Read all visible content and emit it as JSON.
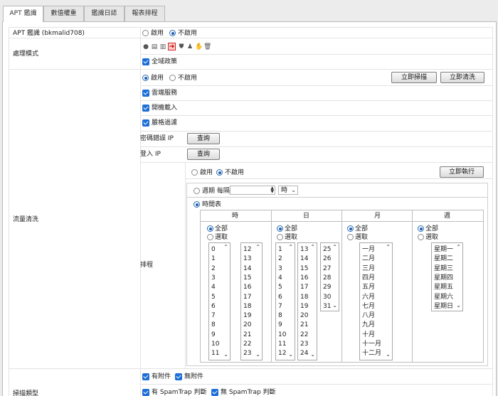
{
  "tabs": [
    "APT 鑑識",
    "數值權重",
    "鑑識日誌",
    "報表排程"
  ],
  "row_apt": {
    "label": "APT 鑑識 (bkmalid708)",
    "opt_on": "啟用",
    "opt_off": "不啟用"
  },
  "mode": {
    "label": "處理模式",
    "icons": [
      "eye-icon",
      "document-icon",
      "table-icon",
      "redirect-icon",
      "shield-icon",
      "user-icon",
      "hand-icon",
      "trash-icon"
    ],
    "global_policy": "全域政策"
  },
  "flow": {
    "label": "流量清洗",
    "opt_on": "啟用",
    "opt_off": "不啟用",
    "scan_now": "立即掃描",
    "clean_now": "立即清洗",
    "cloud": "雲端服務",
    "boot_load": "開機載入",
    "strict_filter": "嚴格過濾",
    "pwd_err_ip": "密碼錯誤 IP",
    "login_ip": "登入 IP",
    "query": "查詢"
  },
  "schedule": {
    "label": "排程",
    "opt_on": "啟用",
    "opt_off": "不啟用",
    "run_now": "立即執行",
    "period": "週期 每隔",
    "unit": "時",
    "timetable": "時間表",
    "all": "全部",
    "select": "選取",
    "hour_header": "時",
    "day_header": "日",
    "month_header": "月",
    "week_header": "週",
    "hours_a": [
      "0",
      "1",
      "2",
      "3",
      "4",
      "5",
      "6",
      "7",
      "8",
      "9",
      "10",
      "11"
    ],
    "hours_b": [
      "12",
      "13",
      "14",
      "15",
      "16",
      "17",
      "18",
      "19",
      "20",
      "21",
      "22",
      "23"
    ],
    "days_a": [
      "1",
      "2",
      "3",
      "4",
      "5",
      "6",
      "7",
      "8",
      "9",
      "10",
      "11",
      "12"
    ],
    "days_b": [
      "13",
      "14",
      "15",
      "16",
      "17",
      "18",
      "19",
      "20",
      "21",
      "22",
      "23",
      "24"
    ],
    "days_c": [
      "25",
      "26",
      "27",
      "28",
      "29",
      "30",
      "31"
    ],
    "months": [
      "一月",
      "二月",
      "三月",
      "四月",
      "五月",
      "六月",
      "七月",
      "八月",
      "九月",
      "十月",
      "十一月",
      "十二月"
    ],
    "weekdays": [
      "星期一",
      "星期二",
      "星期三",
      "星期四",
      "星期五",
      "星期六",
      "星期日"
    ]
  },
  "scan": {
    "label": "掃描類型",
    "with_attach": "有附件",
    "no_attach": "無附件",
    "with_spamtrap": "有 SpamTrap 判斷",
    "no_spamtrap": "無 SpamTrap 判斷"
  }
}
